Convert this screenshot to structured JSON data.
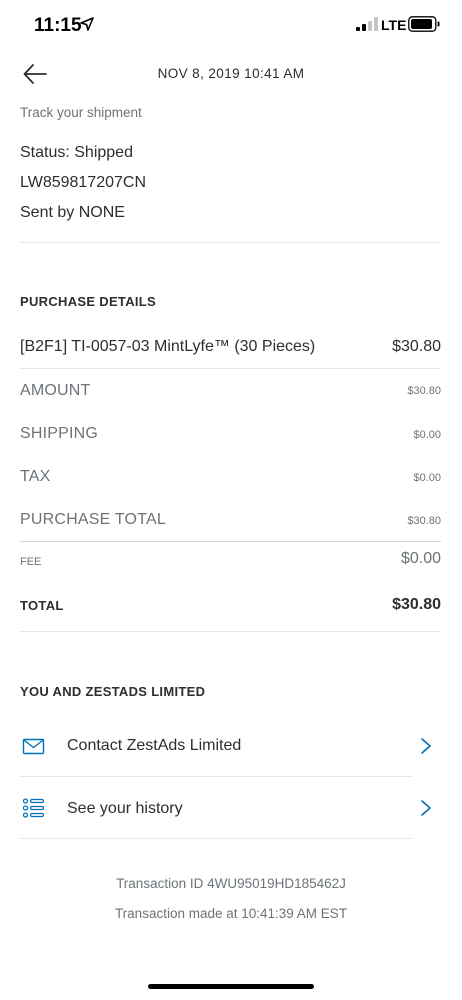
{
  "status_bar": {
    "time": "11:15",
    "network": "LTE"
  },
  "header": {
    "datetime": "NOV 8, 2019  10:41 AM"
  },
  "shipment": {
    "track_label": "Track your shipment",
    "status": "Status: Shipped",
    "tracking_number": "LW859817207CN",
    "sent_by": "Sent by NONE"
  },
  "purchase": {
    "title": "PURCHASE DETAILS",
    "item": {
      "name": "[B2F1] TI-0057-03 MintLyfe™ (30 Pieces)",
      "price": "$30.80"
    },
    "rows": [
      {
        "label": "AMOUNT",
        "value": "$30.80"
      },
      {
        "label": "SHIPPING",
        "value": "$0.00"
      },
      {
        "label": "TAX",
        "value": "$0.00"
      },
      {
        "label": "PURCHASE TOTAL",
        "value": "$30.80"
      }
    ],
    "fee": {
      "label": "FEE",
      "value": "$0.00"
    },
    "total": {
      "label": "TOTAL",
      "value": "$30.80"
    }
  },
  "relationship": {
    "title": "YOU AND ZESTADS LIMITED",
    "links": [
      {
        "label": "Contact ZestAds Limited",
        "icon": "mail-icon"
      },
      {
        "label": "See your history",
        "icon": "list-icon"
      }
    ]
  },
  "footer": {
    "transaction_id": "Transaction ID 4WU95019HD185462J",
    "transaction_time": "Transaction made at 10:41:39 AM EST"
  },
  "colors": {
    "accent": "#0070ba",
    "text": "#2c2e2f",
    "muted": "#6c7378",
    "divider": "#e6e8ea"
  }
}
